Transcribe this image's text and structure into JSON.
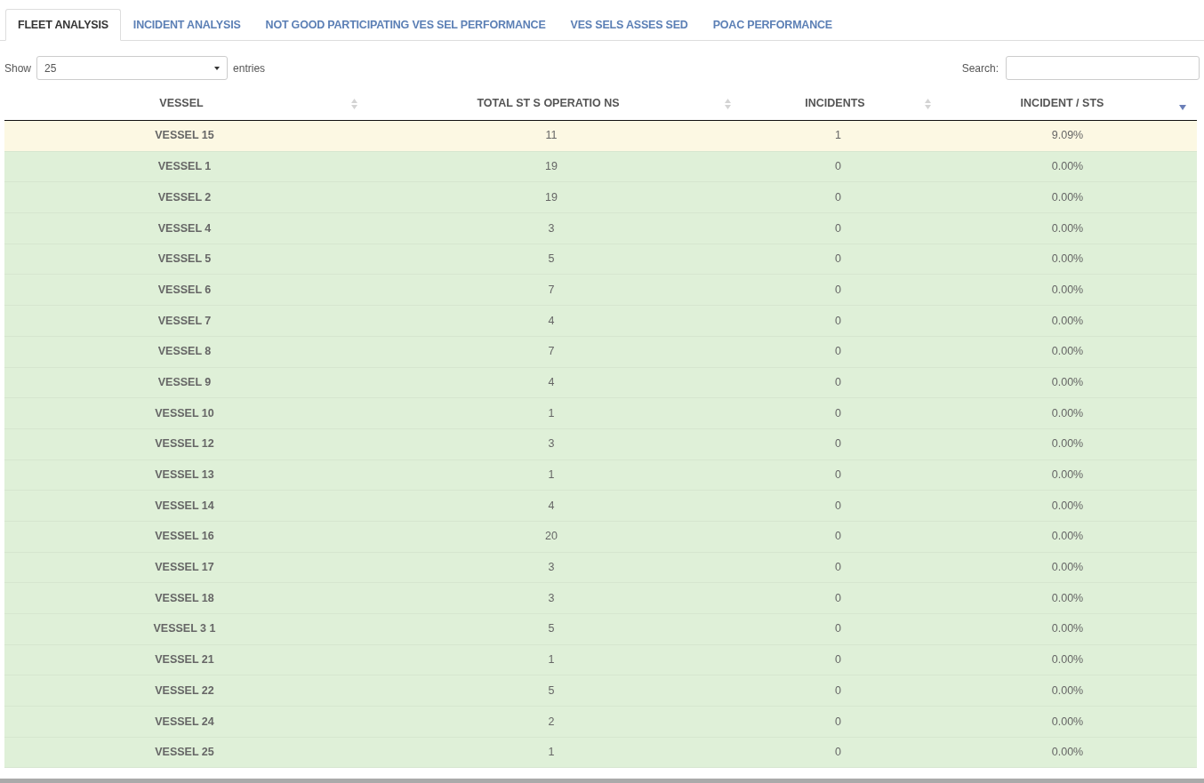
{
  "tabs": [
    {
      "label": "FLEET ANALYSIS",
      "selected": true
    },
    {
      "label": "INCIDENT ANALYSIS",
      "selected": false
    },
    {
      "label": "NOT GOOD PARTICIPATING VES SEL PERFORMANCE",
      "selected": false
    },
    {
      "label": "VES SELS ASSES SED",
      "selected": false
    },
    {
      "label": "POAC PERFORMANCE",
      "selected": false
    }
  ],
  "length_control": {
    "prefix": "Show",
    "value": "25",
    "suffix": "entries"
  },
  "search": {
    "label": "Search:"
  },
  "table": {
    "columns": [
      {
        "label": "VESSEL",
        "sorted": false
      },
      {
        "label": "TOTAL ST S OPERATIO NS",
        "sorted": false
      },
      {
        "label": "INCIDENTS",
        "sorted": false
      },
      {
        "label": "INCIDENT / STS",
        "sorted": true
      }
    ],
    "rows": [
      {
        "warning": true,
        "cells": [
          "VESSEL 15",
          "11",
          "1",
          "9.09%"
        ]
      },
      {
        "warning": false,
        "cells": [
          "VESSEL 1",
          "19",
          "0",
          "0.00%"
        ]
      },
      {
        "warning": false,
        "cells": [
          "VESSEL 2",
          "19",
          "0",
          "0.00%"
        ]
      },
      {
        "warning": false,
        "cells": [
          "VESSEL 4",
          "3",
          "0",
          "0.00%"
        ]
      },
      {
        "warning": false,
        "cells": [
          "VESSEL 5",
          "5",
          "0",
          "0.00%"
        ]
      },
      {
        "warning": false,
        "cells": [
          "VESSEL 6",
          "7",
          "0",
          "0.00%"
        ]
      },
      {
        "warning": false,
        "cells": [
          "VESSEL 7",
          "4",
          "0",
          "0.00%"
        ]
      },
      {
        "warning": false,
        "cells": [
          "VESSEL 8",
          "7",
          "0",
          "0.00%"
        ]
      },
      {
        "warning": false,
        "cells": [
          "VESSEL 9",
          "4",
          "0",
          "0.00%"
        ]
      },
      {
        "warning": false,
        "cells": [
          "VESSEL 10",
          "1",
          "0",
          "0.00%"
        ]
      },
      {
        "warning": false,
        "cells": [
          "VESSEL 12",
          "3",
          "0",
          "0.00%"
        ]
      },
      {
        "warning": false,
        "cells": [
          "VESSEL 13",
          "1",
          "0",
          "0.00%"
        ]
      },
      {
        "warning": false,
        "cells": [
          "VESSEL 14",
          "4",
          "0",
          "0.00%"
        ]
      },
      {
        "warning": false,
        "cells": [
          "VESSEL 16",
          "20",
          "0",
          "0.00%"
        ]
      },
      {
        "warning": false,
        "cells": [
          "VESSEL 17",
          "3",
          "0",
          "0.00%"
        ]
      },
      {
        "warning": false,
        "cells": [
          "VESSEL 18",
          "3",
          "0",
          "0.00%"
        ]
      },
      {
        "warning": false,
        "cells": [
          "VESSEL 3 1",
          "5",
          "0",
          "0.00%"
        ]
      },
      {
        "warning": false,
        "cells": [
          "VESSEL 21",
          "1",
          "0",
          "0.00%"
        ]
      },
      {
        "warning": false,
        "cells": [
          "VESSEL 22",
          "5",
          "0",
          "0.00%"
        ]
      },
      {
        "warning": false,
        "cells": [
          "VESSEL 24",
          "2",
          "0",
          "0.00%"
        ]
      },
      {
        "warning": false,
        "cells": [
          "VESSEL 25",
          "1",
          "0",
          "0.00%"
        ]
      }
    ]
  }
}
